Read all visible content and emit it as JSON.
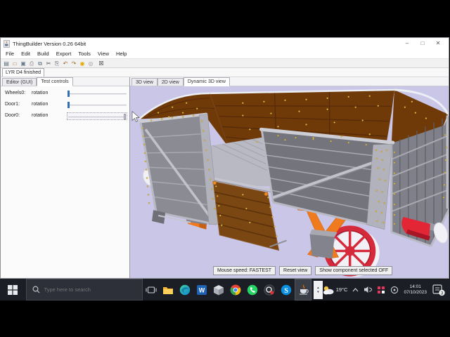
{
  "window": {
    "title": "ThingBuilder Version 0.26 64bit",
    "minimize": "–",
    "maximize": "□",
    "close": "✕"
  },
  "menu": {
    "items": [
      "File",
      "Edit",
      "Build",
      "Export",
      "Tools",
      "View",
      "Help"
    ]
  },
  "toolbar": {
    "icons": [
      {
        "name": "new",
        "glyph": "▤"
      },
      {
        "name": "open",
        "glyph": "▭"
      },
      {
        "name": "save",
        "glyph": "▣"
      },
      {
        "name": "print",
        "glyph": "⎙"
      },
      {
        "name": "copy",
        "glyph": "⧉"
      },
      {
        "name": "cut",
        "glyph": "✂"
      },
      {
        "name": "paste",
        "glyph": "⎘"
      },
      {
        "name": "undo",
        "glyph": "↶"
      },
      {
        "name": "redo",
        "glyph": "↷"
      },
      {
        "name": "light-on",
        "glyph": "◉"
      },
      {
        "name": "light-off",
        "glyph": "◎"
      },
      {
        "name": "exit",
        "glyph": "☒"
      }
    ]
  },
  "document_tab": {
    "label": "LYR D4 finished"
  },
  "left_panel": {
    "tabs": [
      {
        "label": "Editor (GUI)",
        "active": false
      },
      {
        "label": "Test controls",
        "active": true
      }
    ],
    "controls": [
      {
        "label": "Wheels0:",
        "property": "rotation",
        "value_percent": 0,
        "focused": false
      },
      {
        "label": "Door1:",
        "property": "rotation",
        "value_percent": 0,
        "focused": false
      },
      {
        "label": "Door0:",
        "property": "rotation",
        "value_percent": 100,
        "focused": true
      }
    ]
  },
  "view_tabs": [
    {
      "label": "3D view",
      "active": false
    },
    {
      "label": "2D view",
      "active": false
    },
    {
      "label": "Dynamic 3D view",
      "active": true
    }
  ],
  "viewport": {
    "buttons": [
      "Mouse speed: FASTEST",
      "Reset view",
      "Show component selected OFF"
    ],
    "colors": {
      "background": "#c9c6e8",
      "wood_interior": "#6f3a08",
      "wood_door": "#7a4612",
      "panel_grey": "#85858d",
      "frame_silver": "#c6c6d0",
      "underframe_orange": "#f07a1e",
      "wheel_red": "#d52a3c",
      "bolt_gold": "#e6c44a",
      "buffer_red": "#e32636"
    }
  },
  "taskbar": {
    "search_placeholder": "Type here to search",
    "spinner": {
      "up": "▴",
      "down": "▾"
    },
    "tray": {
      "temperature": "19°C",
      "time": "14:01",
      "date": "07/10/2023",
      "notification_count": "3"
    }
  }
}
